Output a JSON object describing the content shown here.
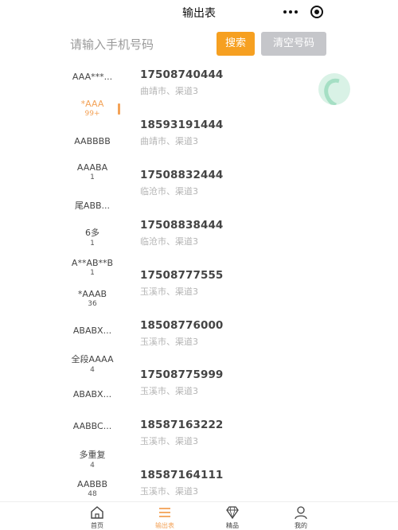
{
  "header": {
    "title": "输出表"
  },
  "search": {
    "placeholder": "请输入手机号码",
    "search_label": "搜索",
    "clear_label": "清空号码"
  },
  "categories": [
    {
      "label": "AAA***...",
      "count": ""
    },
    {
      "label": "*AAA",
      "count": "99+"
    },
    {
      "label": "AABBBB",
      "count": ""
    },
    {
      "label": "AAABA",
      "count": "1"
    },
    {
      "label": "尾ABB...",
      "count": ""
    },
    {
      "label": "6多",
      "count": "1"
    },
    {
      "label": "A**AB**B",
      "count": "1"
    },
    {
      "label": "*AAAB",
      "count": "36"
    },
    {
      "label": "ABABX...",
      "count": ""
    },
    {
      "label": "全段AAAA",
      "count": "4"
    },
    {
      "label": "ABABX...",
      "count": ""
    },
    {
      "label": "AABBC...",
      "count": ""
    },
    {
      "label": "多重复",
      "count": "4"
    },
    {
      "label": "AABBB",
      "count": "48"
    }
  ],
  "numbers": [
    {
      "number": "17508740444",
      "location": "曲靖市、渠道3"
    },
    {
      "number": "18593191444",
      "location": "曲靖市、渠道3"
    },
    {
      "number": "17508832444",
      "location": "临沧市、渠道3"
    },
    {
      "number": "17508838444",
      "location": "临沧市、渠道3"
    },
    {
      "number": "17508777555",
      "location": "玉溪市、渠道3"
    },
    {
      "number": "18508776000",
      "location": "玉溪市、渠道3"
    },
    {
      "number": "17508775999",
      "location": "玉溪市、渠道3"
    },
    {
      "number": "18587163222",
      "location": "玉溪市、渠道3"
    },
    {
      "number": "18587164111",
      "location": "玉溪市、渠道3"
    }
  ],
  "tabbar": [
    {
      "label": "首页",
      "icon": "home-icon"
    },
    {
      "label": "输出表",
      "icon": "list-icon"
    },
    {
      "label": "精品",
      "icon": "diamond-icon"
    },
    {
      "label": "我的",
      "icon": "user-icon"
    }
  ],
  "colors": {
    "accent": "#f3a257",
    "search_button": "#f6a021",
    "clear_button": "#c5c6ca"
  }
}
